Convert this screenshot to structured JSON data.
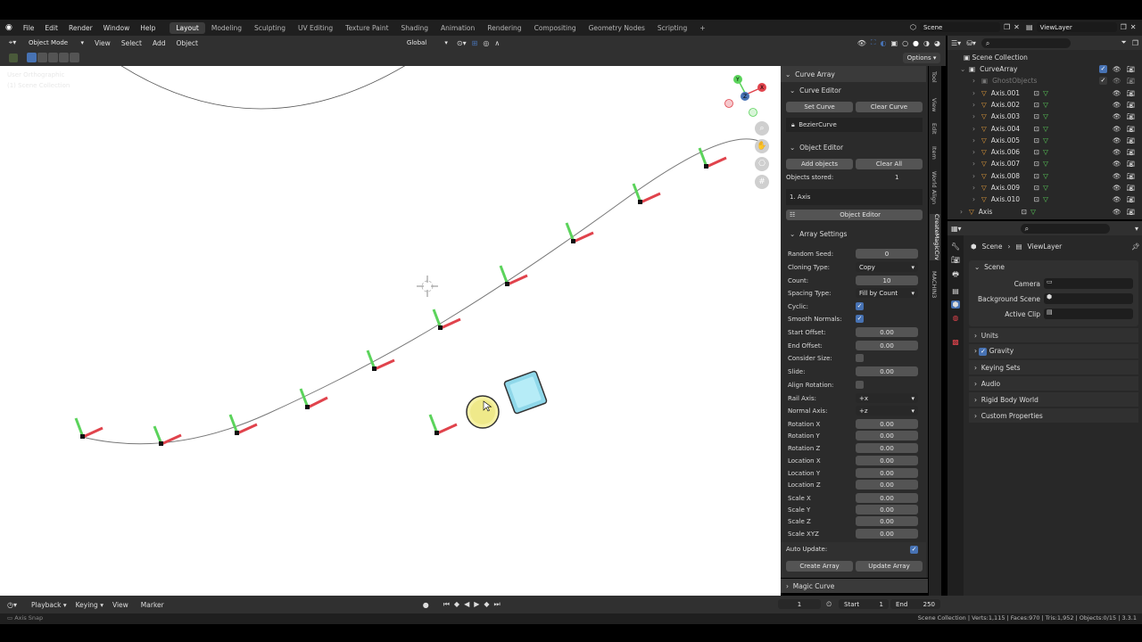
{
  "top_menu": {
    "items": [
      "File",
      "Edit",
      "Render",
      "Window",
      "Help"
    ]
  },
  "workspaces": [
    "Layout",
    "Modeling",
    "Sculpting",
    "UV Editing",
    "Texture Paint",
    "Shading",
    "Animation",
    "Rendering",
    "Compositing",
    "Geometry Nodes",
    "Scripting"
  ],
  "active_workspace": "Layout",
  "add_tab": "+",
  "scene": {
    "name": "Scene",
    "view_layer": "ViewLayer"
  },
  "viewport_header": {
    "mode": "Object Mode",
    "menus": [
      "View",
      "Select",
      "Add",
      "Object"
    ],
    "orientation": "Global",
    "options_label": "Options"
  },
  "viewport": {
    "view_name": "User Orthographic",
    "collection": "(1) Scene Collection",
    "gizmo_axes": [
      "Y",
      "Z",
      "X"
    ]
  },
  "sidebar_tabs": [
    "Tool",
    "View",
    "Edit",
    "Item",
    "World Align",
    "CreateMagicCrv",
    "MACHIN3"
  ],
  "curve_array": {
    "title": "Curve Array",
    "curve_editor": {
      "title": "Curve Editor",
      "set_curve": "Set Curve",
      "clear_curve": "Clear Curve",
      "curve_name": "BezierCurve"
    },
    "object_editor": {
      "title": "Object Editor",
      "add_objects": "Add objects",
      "clear_all": "Clear All",
      "objects_stored_label": "Objects stored:",
      "objects_stored_value": "1",
      "list_item": "1. Axis",
      "object_editor_btn": "Object Editor"
    },
    "array_settings": {
      "title": "Array Settings",
      "random_seed": {
        "label": "Random Seed:",
        "value": "0"
      },
      "cloning_type": {
        "label": "Cloning Type:",
        "value": "Copy"
      },
      "count": {
        "label": "Count:",
        "value": "10"
      },
      "spacing_type": {
        "label": "Spacing Type:",
        "value": "Fill by Count"
      },
      "cyclic": {
        "label": "Cyclic:",
        "checked": true
      },
      "smooth_normals": {
        "label": "Smooth Normals:",
        "checked": true
      },
      "start_offset": {
        "label": "Start Offset:",
        "value": "0.00"
      },
      "end_offset": {
        "label": "End Offset:",
        "value": "0.00"
      },
      "consider_size": {
        "label": "Consider Size:",
        "checked": false
      },
      "slide": {
        "label": "Slide:",
        "value": "0.00"
      },
      "align_rotation": {
        "label": "Align Rotation:",
        "checked": false
      },
      "rail_axis": {
        "label": "Rail Axis:",
        "value": "+x"
      },
      "normal_axis": {
        "label": "Normal Axis:",
        "value": "+z"
      },
      "rotation_x": {
        "label": "Rotation X",
        "value": "0.00"
      },
      "rotation_y": {
        "label": "Rotation Y",
        "value": "0.00"
      },
      "rotation_z": {
        "label": "Rotation Z",
        "value": "0.00"
      },
      "location_x": {
        "label": "Location X",
        "value": "0.00"
      },
      "location_y": {
        "label": "Location Y",
        "value": "0.00"
      },
      "location_z": {
        "label": "Location Z",
        "value": "0.00"
      },
      "scale_x": {
        "label": "Scale X",
        "value": "0.00"
      },
      "scale_y": {
        "label": "Scale Y",
        "value": "0.00"
      },
      "scale_z": {
        "label": "Scale Z",
        "value": "0.00"
      },
      "scale_xyz": {
        "label": "Scale XYZ",
        "value": "0.00"
      }
    },
    "auto_update_label": "Auto Update:",
    "create_array": "Create Array",
    "update_array": "Update Array"
  },
  "magic_curve": {
    "title": "Magic Curve"
  },
  "outliner": {
    "root": "Scene Collection",
    "items": [
      {
        "name": "CurveArray",
        "level": 1,
        "type": "collection"
      },
      {
        "name": "GhostObjects",
        "level": 2,
        "type": "collection-dim"
      },
      {
        "name": "Axis.001",
        "level": 2,
        "type": "object"
      },
      {
        "name": "Axis.002",
        "level": 2,
        "type": "object"
      },
      {
        "name": "Axis.003",
        "level": 2,
        "type": "object"
      },
      {
        "name": "Axis.004",
        "level": 2,
        "type": "object"
      },
      {
        "name": "Axis.005",
        "level": 2,
        "type": "object"
      },
      {
        "name": "Axis.006",
        "level": 2,
        "type": "object"
      },
      {
        "name": "Axis.007",
        "level": 2,
        "type": "object"
      },
      {
        "name": "Axis.008",
        "level": 2,
        "type": "object"
      },
      {
        "name": "Axis.009",
        "level": 2,
        "type": "object"
      },
      {
        "name": "Axis.010",
        "level": 2,
        "type": "object"
      },
      {
        "name": "Axis",
        "level": 1,
        "type": "object"
      }
    ]
  },
  "properties": {
    "breadcrumb": [
      "Scene",
      "ViewLayer"
    ],
    "scene_title": "Scene",
    "camera_label": "Camera",
    "background_scene_label": "Background Scene",
    "active_clip_label": "Active Clip",
    "sections": [
      "Units",
      "Gravity",
      "Keying Sets",
      "Audio",
      "Rigid Body World",
      "Custom Properties"
    ]
  },
  "timeline": {
    "menus": [
      "Playback",
      "Keying",
      "View",
      "Marker"
    ],
    "current_frame": "1",
    "start_label": "Start",
    "start": "1",
    "end_label": "End",
    "end": "250"
  },
  "status": {
    "left": "Axis Snap",
    "right": "Scene Collection | Verts:1,115 | Faces:970 | Tris:1,952 | Objects:0/15 | 3.3.1"
  },
  "colors": {
    "accent": "#4772b3",
    "x_axis": "#e0434c",
    "y_axis": "#5bd35b",
    "viewport_bg": "#ffffff",
    "panel_bg": "#303030"
  }
}
